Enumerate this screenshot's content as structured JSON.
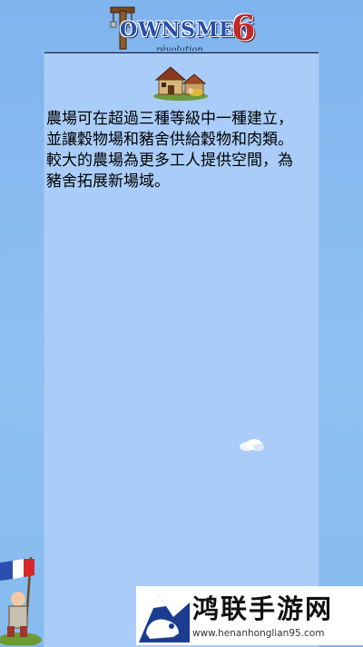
{
  "logo": {
    "title": "OWNSMEN",
    "number": "6",
    "subtitle": "révolution"
  },
  "building": {
    "icon": "farm-building-icon"
  },
  "description": "農場可在超過三種等級中一種建立，\n並讓穀物場和豬舍供給穀物和肉類。\n較大的農場為更多工人提供空間，為\n豬舍拓展新場域。",
  "watermark": {
    "title": "鸿联手游网",
    "url": "www.henanhonglian95.com",
    "icon": "bison-logo-icon"
  },
  "colors": {
    "background": "#8fc0f2",
    "panel": "#a9cdf8",
    "panel_border": "#3b5588"
  }
}
